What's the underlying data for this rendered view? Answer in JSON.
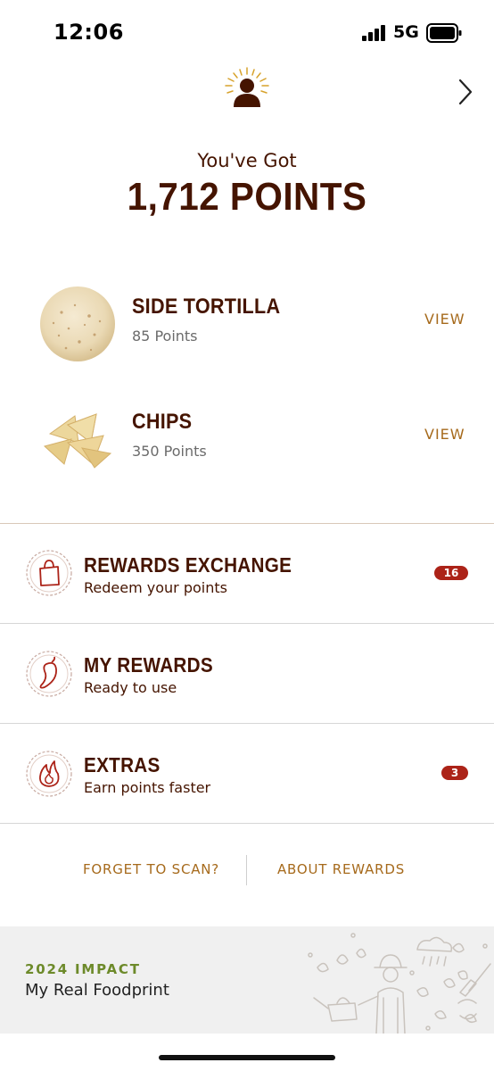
{
  "status": {
    "time": "12:06",
    "network": "5G"
  },
  "header": {
    "intro": "You've Got",
    "points": "1,712 POINTS"
  },
  "rewards": [
    {
      "title": "SIDE TORTILLA",
      "points": "85 Points",
      "action": "VIEW"
    },
    {
      "title": "CHIPS",
      "points": "350 Points",
      "action": "VIEW"
    }
  ],
  "menu": [
    {
      "title": "REWARDS EXCHANGE",
      "subtitle": "Redeem your points",
      "badge": "16",
      "icon": "shopping-bag-icon"
    },
    {
      "title": "MY REWARDS",
      "subtitle": "Ready to use",
      "badge": "",
      "icon": "pepper-icon"
    },
    {
      "title": "EXTRAS",
      "subtitle": "Earn points faster",
      "badge": "3",
      "icon": "flame-icon"
    }
  ],
  "links": {
    "forget": "FORGET TO SCAN?",
    "about": "ABOUT REWARDS"
  },
  "impact": {
    "year": "2024 IMPACT",
    "title": "My Real Foodprint"
  },
  "colors": {
    "brown": "#451400",
    "gold": "#a66a1c",
    "red": "#ac2318",
    "green": "#6d8a2a"
  }
}
